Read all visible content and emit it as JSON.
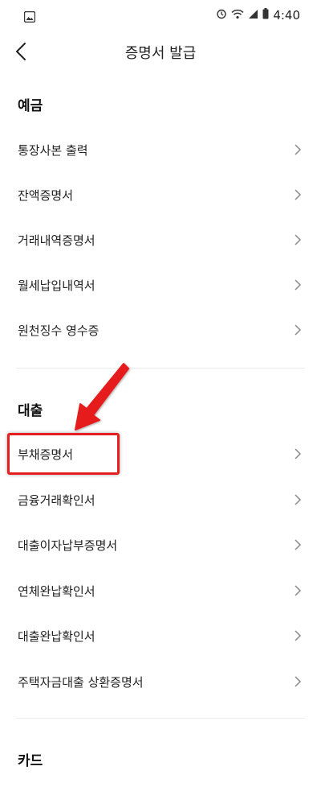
{
  "status_bar": {
    "time": "4:40"
  },
  "header": {
    "title": "증명서 발급"
  },
  "sections": [
    {
      "title": "예금",
      "items": [
        "통장사본 출력",
        "잔액증명서",
        "거래내역증명서",
        "월세납입내역서",
        "원천징수 영수증"
      ]
    },
    {
      "title": "대출",
      "items": [
        "부채증명서",
        "금융거래확인서",
        "대출이자납부증명서",
        "연체완납확인서",
        "대출완납확인서",
        "주택자금대출 상환증명서"
      ]
    },
    {
      "title": "카드",
      "items": []
    }
  ],
  "annotation": {
    "color": "#e61e1e"
  }
}
